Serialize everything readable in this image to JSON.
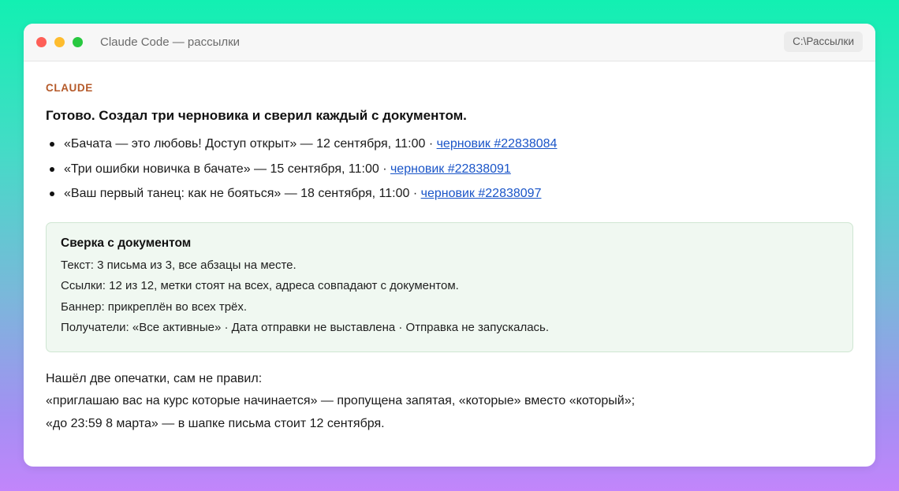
{
  "window": {
    "title": "Claude Code — рассылки",
    "path": "C:\\Рассылки"
  },
  "message": {
    "speaker": "CLAUDE",
    "headline": "Готово. Создал три черновика и сверил каждый с документом.",
    "drafts": [
      {
        "text": "«Бачата — это любовь! Доступ открыт» — 12 сентября, 11:00 · ",
        "link": "черновик #22838084"
      },
      {
        "text": "«Три ошибки новичка в бачате» — 15 сентября, 11:00 · ",
        "link": "черновик #22838091"
      },
      {
        "text": "«Ваш первый танец: как не бояться» — 18 сентября, 11:00 · ",
        "link": "черновик #22838097"
      }
    ],
    "check": {
      "title": "Сверка с документом",
      "lines": [
        "Текст: 3 письма из 3, все абзацы на месте.",
        "Ссылки: 12 из 12, метки стоят на всех, адреса совпадают с документом.",
        "Баннер: прикреплён во всех трёх.",
        "Получатели: «Все активные» · Дата отправки не выставлена · Отправка не запускалась."
      ]
    },
    "notes": [
      "Нашёл две опечатки, сам не правил:",
      "«приглашаю вас на курс которые начинается» — пропущена запятая, «которые» вместо «который»;",
      "«до 23:59 8 марта» — в шапке письма стоит 12 сентября."
    ]
  }
}
